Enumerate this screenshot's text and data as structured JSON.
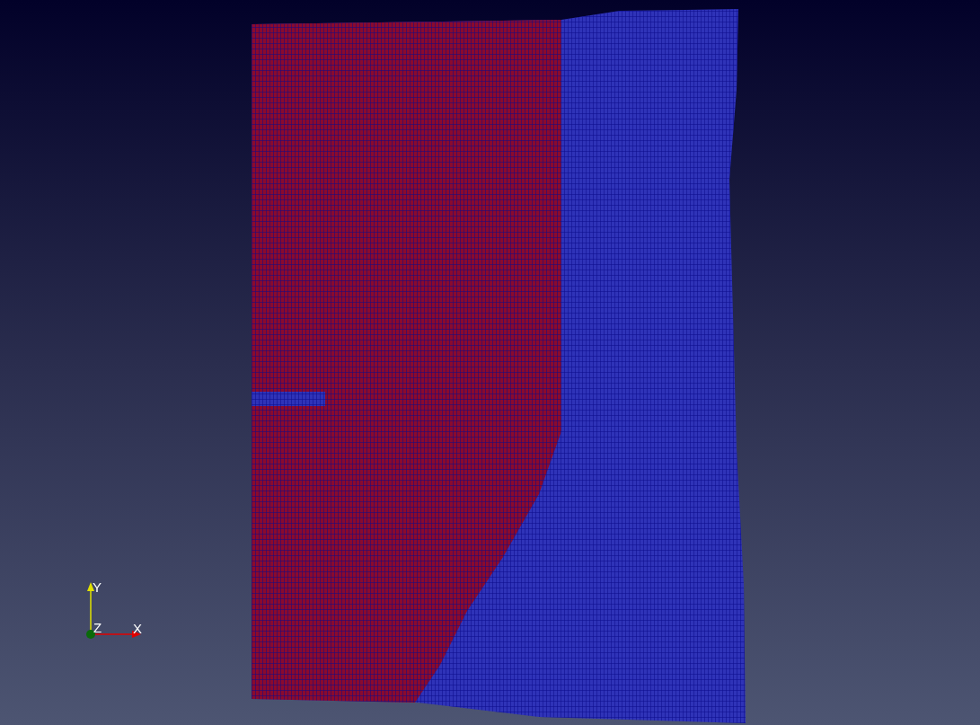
{
  "orientation_axes": {
    "y_label": "Y",
    "z_label": "Z",
    "x_label": "X"
  }
}
